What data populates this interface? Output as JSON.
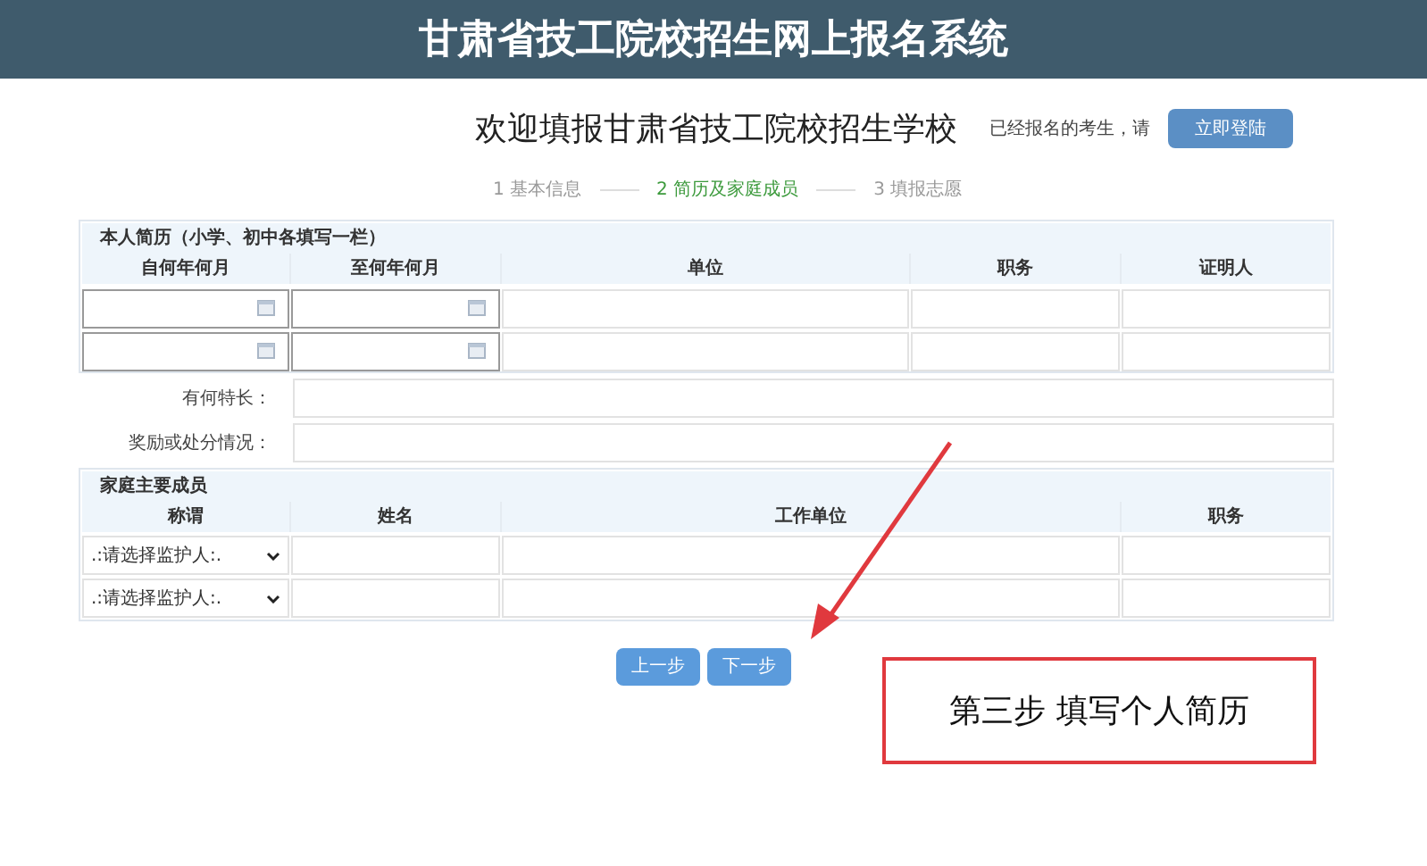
{
  "header": {
    "title": "甘肃省技工院校招生网上报名系统"
  },
  "welcome": {
    "title": "欢迎填报甘肃省技工院校招生学校",
    "note": "已经报名的考生，请",
    "login_button": "立即登陆"
  },
  "steps": [
    {
      "label": "1 基本信息",
      "selected": false
    },
    {
      "label": "2 简历及家庭成员",
      "selected": true
    },
    {
      "label": "3 填报志愿",
      "selected": false
    }
  ],
  "resume": {
    "title": "本人简历（小学、初中各填写一栏）",
    "columns": [
      "自何年何月",
      "至何年何月",
      "单位",
      "职务",
      "证明人"
    ],
    "rows": [
      {
        "kind": "empty"
      },
      {
        "kind": "empty"
      }
    ]
  },
  "extra_fields": [
    {
      "label": "有何特长："
    },
    {
      "label": "奖励或处分情况："
    }
  ],
  "family": {
    "title": "家庭主要成员",
    "columns": [
      "称谓",
      "姓名",
      "工作单位",
      "职务"
    ],
    "rows": [
      {
        "relation": ".:请选择监护人:."
      },
      {
        "relation": ".:请选择监护人:."
      }
    ]
  },
  "buttons": [
    "上一步",
    "下一步"
  ],
  "annotation": {
    "caption": "第三步 填写个人简历"
  }
}
